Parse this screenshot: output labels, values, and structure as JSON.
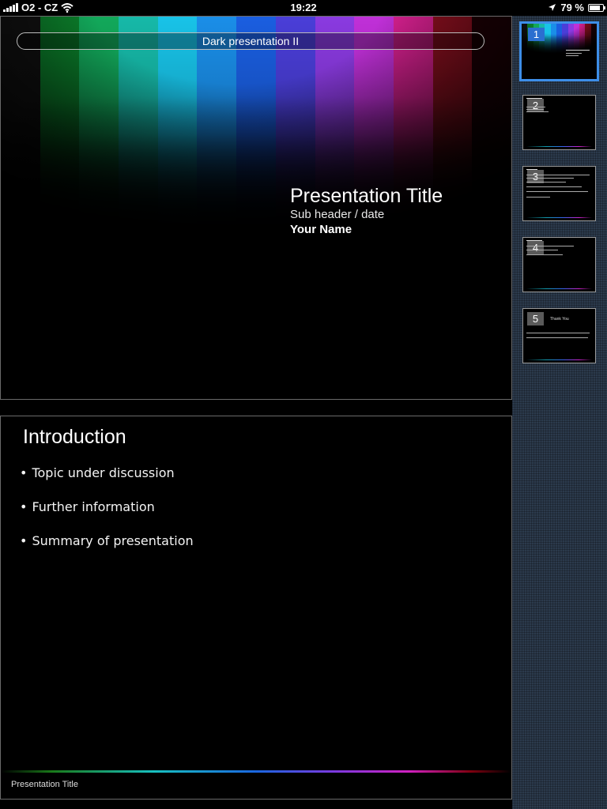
{
  "status_bar": {
    "carrier": "O2 - CZ",
    "time": "19:22",
    "battery_percent": "79 %",
    "battery_level": 0.79
  },
  "slides": [
    {
      "banner": "Dark presentation II",
      "title": "Presentation Title",
      "subheader": "Sub header / date",
      "author": "Your Name"
    },
    {
      "title": "Introduction",
      "bullets": [
        "Topic under discussion",
        "Further information",
        "Summary of presentation"
      ],
      "footer": "Presentation Title"
    }
  ],
  "thumbnails": [
    {
      "number": "1",
      "selected": true
    },
    {
      "number": "2",
      "selected": false
    },
    {
      "number": "3",
      "selected": false
    },
    {
      "number": "4",
      "selected": false
    },
    {
      "number": "5",
      "selected": false,
      "caption": "Thank You"
    }
  ],
  "spectrum_colors": [
    "#111",
    "#0b7d2a",
    "#12a85a",
    "#16b9a8",
    "#18c3e8",
    "#1a8ee8",
    "#1a5ee0",
    "#4a3ed8",
    "#8a3ae0",
    "#c030d8",
    "#d82090",
    "#901020",
    "#200005"
  ],
  "accent_color": "#3d8ee8"
}
